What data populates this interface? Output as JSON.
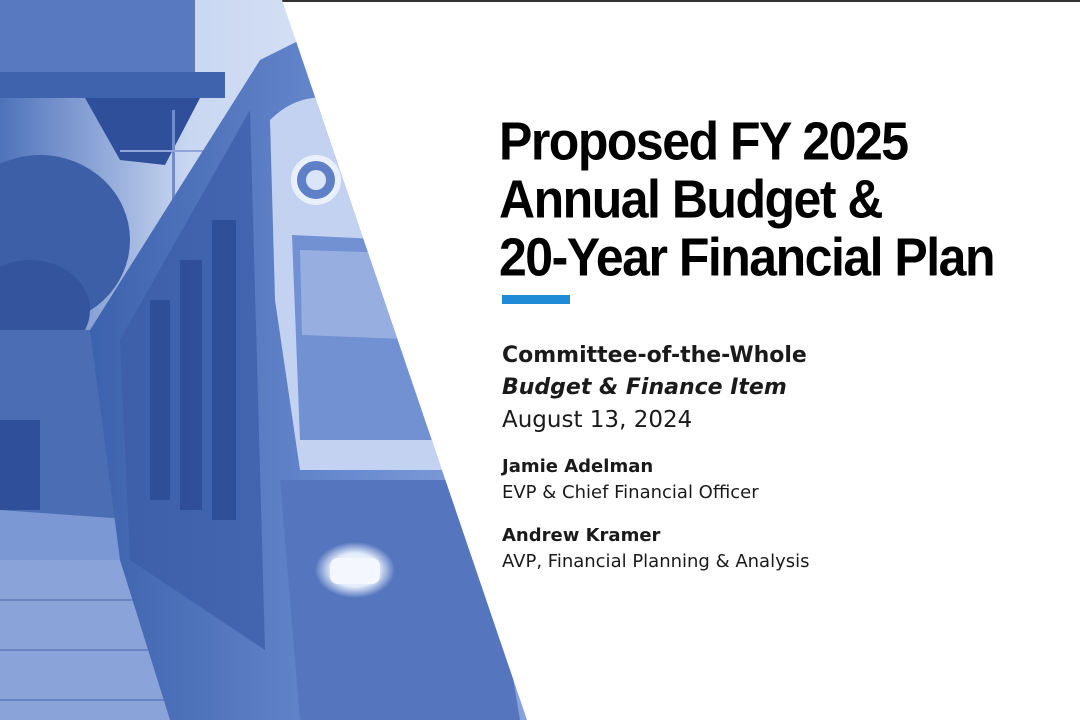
{
  "slide": {
    "title_lines": [
      "Proposed FY 2025",
      "Annual Budget &",
      "20-Year Financial Plan"
    ],
    "committee": "Committee-of-the-Whole",
    "item": "Budget & Finance Item",
    "date": "August 13, 2024",
    "presenters": [
      {
        "name": "Jamie Adelman",
        "role": "EVP & Chief Financial Officer"
      },
      {
        "name": "Andrew Kramer",
        "role": "AVP, Financial Planning & Analysis"
      }
    ]
  },
  "colors": {
    "accent": "#1f8ad6",
    "photo_dark": "#2f4f9a",
    "photo_mid": "#5a7ec4",
    "photo_light": "#dfe8f8"
  }
}
